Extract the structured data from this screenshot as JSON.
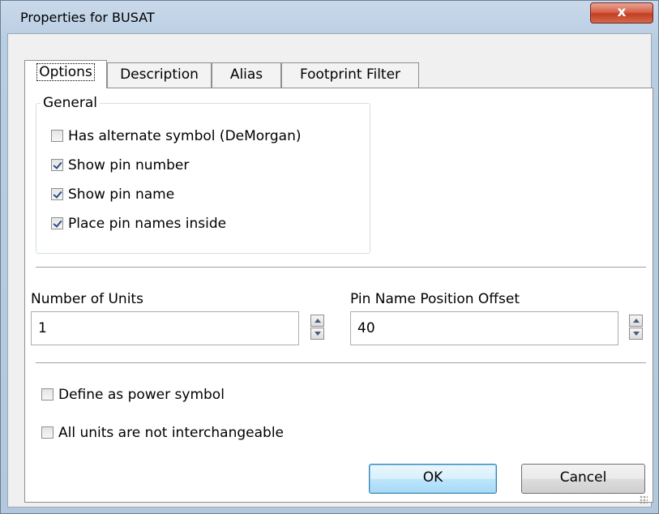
{
  "window": {
    "title": "Properties for BUSAT",
    "close_glyph": "x"
  },
  "tabs": [
    {
      "label": "Options",
      "active": true
    },
    {
      "label": "Description",
      "active": false
    },
    {
      "label": "Alias",
      "active": false
    },
    {
      "label": "Footprint Filter",
      "active": false
    }
  ],
  "general": {
    "title": "General",
    "options": [
      {
        "label": "Has alternate symbol (DeMorgan)",
        "checked": false
      },
      {
        "label": "Show pin number",
        "checked": true
      },
      {
        "label": "Show pin name",
        "checked": true
      },
      {
        "label": "Place pin names inside",
        "checked": true
      }
    ]
  },
  "units": {
    "label": "Number of Units",
    "value": "1"
  },
  "pin_offset": {
    "label": "Pin Name Position Offset",
    "value": "40"
  },
  "flags": [
    {
      "label": "Define as power symbol",
      "checked": false
    },
    {
      "label": "All units are not interchangeable",
      "checked": false
    }
  ],
  "buttons": {
    "ok": "OK",
    "cancel": "Cancel"
  },
  "colors": {
    "title_bar": "#c9d9ea",
    "close_button": "#c23f22",
    "ok_button_border": "#3c7fb1"
  },
  "icons": [
    "close-icon",
    "checkbox-icon",
    "spin-up-icon",
    "spin-down-icon",
    "resize-grip-icon"
  ]
}
